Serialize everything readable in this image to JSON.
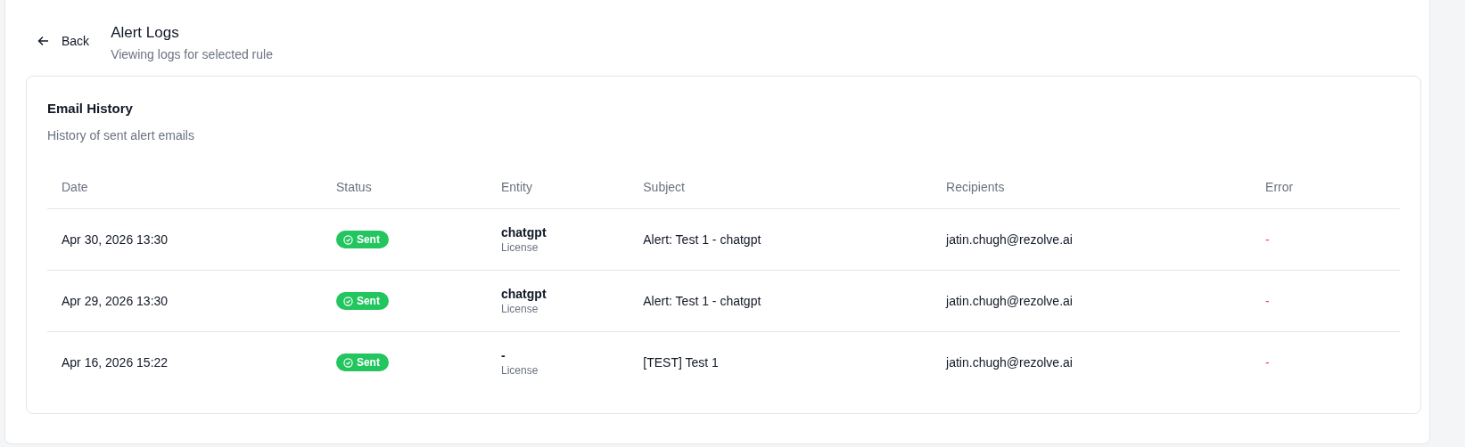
{
  "header": {
    "back": "Back",
    "title": "Alert Logs",
    "subtitle": "Viewing logs for selected rule"
  },
  "card": {
    "title": "Email History",
    "subtitle": "History of sent alert emails"
  },
  "table": {
    "columns": [
      "Date",
      "Status",
      "Entity",
      "Subject",
      "Recipients",
      "Error"
    ],
    "rows": [
      {
        "date": "Apr 30, 2026 13:30",
        "status": {
          "kind": "sent",
          "label": "Sent"
        },
        "entity": "chatgpt",
        "entity_type": "License",
        "subject": "Alert: Test 1 - chatgpt",
        "recipients": "jatin.chugh@rezolve.ai",
        "error": "-"
      },
      {
        "date": "Apr 29, 2026 13:30",
        "status": {
          "kind": "sent",
          "label": "Sent"
        },
        "entity": "chatgpt",
        "entity_type": "License",
        "subject": "Alert: Test 1 - chatgpt",
        "recipients": "jatin.chugh@rezolve.ai",
        "error": "-"
      },
      {
        "date": "Apr 16, 2026 15:22",
        "status": {
          "kind": "sent",
          "label": "Sent"
        },
        "entity": "-",
        "entity_type": "License",
        "subject": "[TEST] Test 1",
        "recipients": "jatin.chugh@rezolve.ai",
        "error": "-"
      }
    ]
  }
}
